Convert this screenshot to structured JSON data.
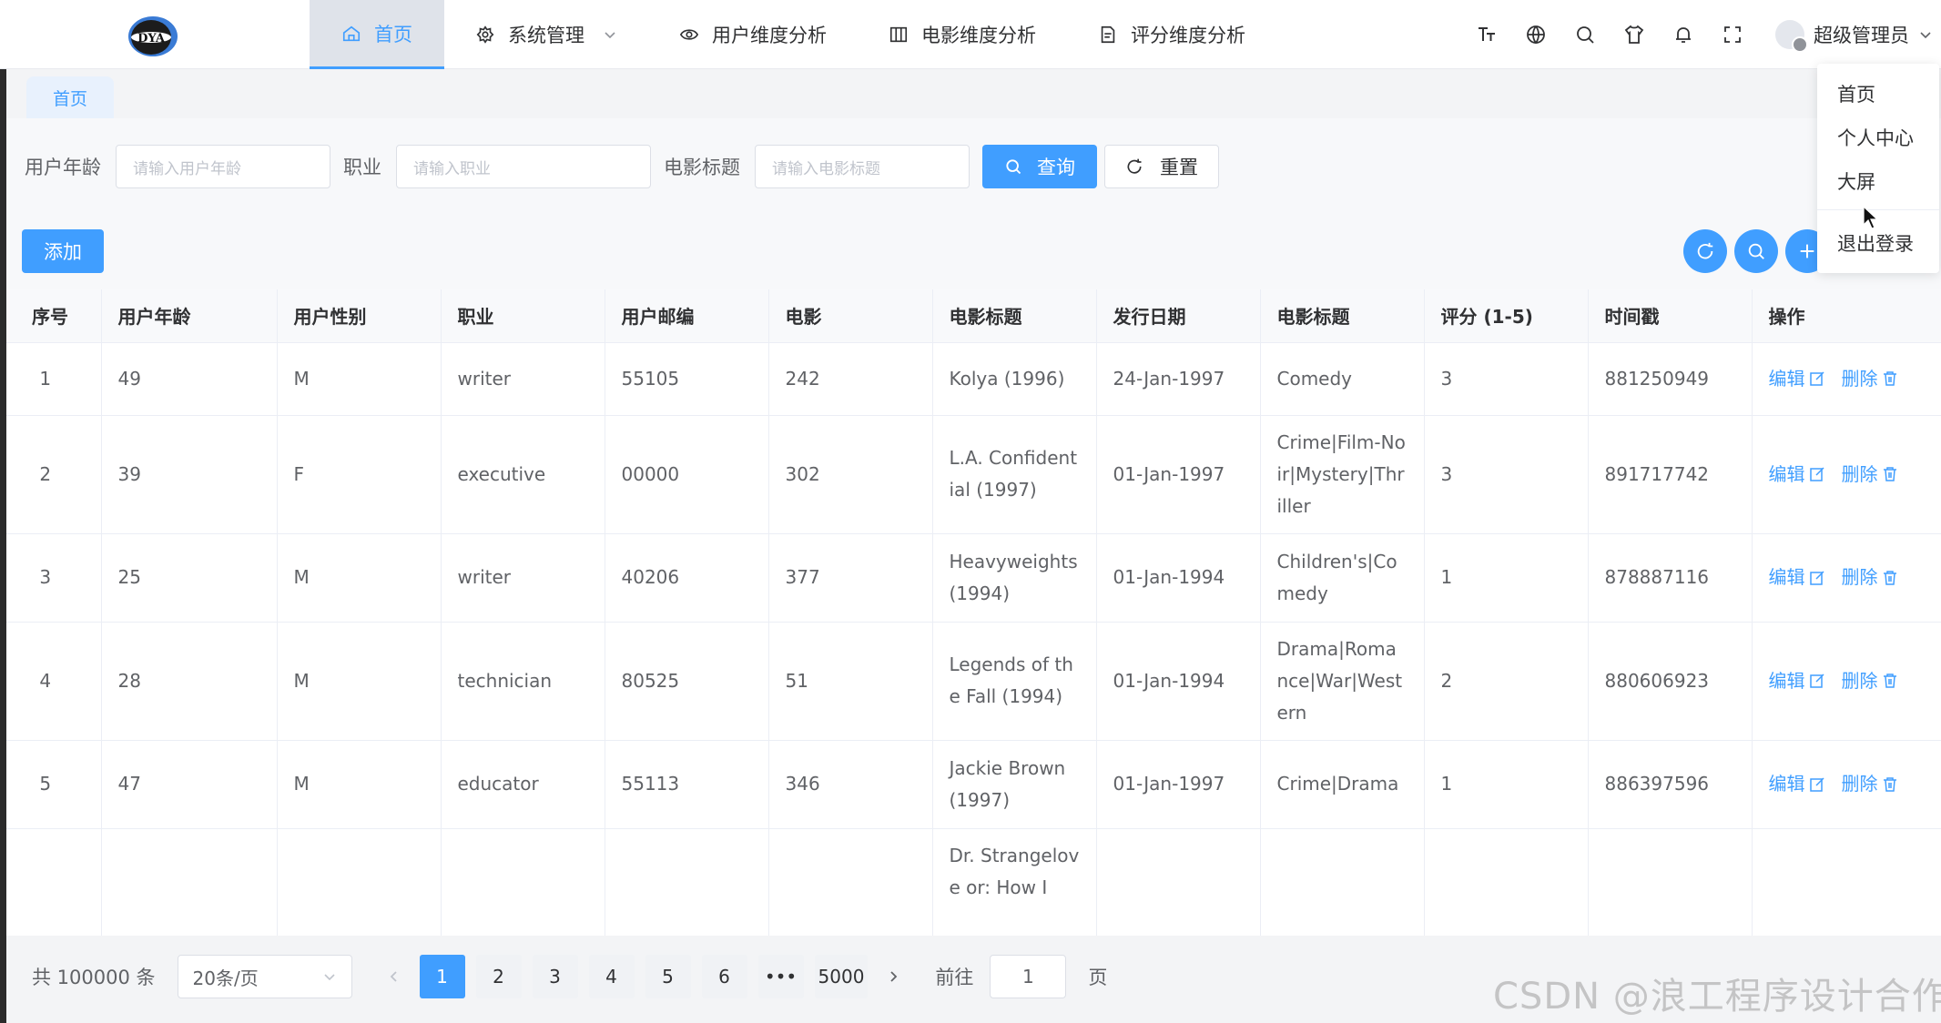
{
  "header": {
    "logo_text": "DYA",
    "nav": [
      {
        "label": "首页",
        "icon": "home-icon",
        "active": true
      },
      {
        "label": "系统管理",
        "icon": "gear-icon",
        "has_caret": true
      },
      {
        "label": "用户维度分析",
        "icon": "eye-icon"
      },
      {
        "label": "电影维度分析",
        "icon": "columns-icon"
      },
      {
        "label": "评分维度分析",
        "icon": "document-icon"
      }
    ],
    "tools": [
      "font-size-icon",
      "globe-icon",
      "search-icon",
      "shirt-icon",
      "bell-icon",
      "fullscreen-icon"
    ],
    "user_name": "超级管理员"
  },
  "tabs": [
    {
      "label": "首页",
      "active": true
    }
  ],
  "search": {
    "age_label": "用户年龄",
    "age_placeholder": "请输入用户年龄",
    "occupation_label": "职业",
    "occupation_placeholder": "请输入职业",
    "title_label": "电影标题",
    "title_placeholder": "请输入电影标题",
    "query_label": "查询",
    "reset_label": "重置"
  },
  "toolbar": {
    "add_label": "添加"
  },
  "table": {
    "columns": [
      "序号",
      "用户年龄",
      "用户性别",
      "职业",
      "用户邮编",
      "电影",
      "电影标题",
      "发行日期",
      "电影标题",
      "评分 (1-5)",
      "时间戳",
      "操作"
    ],
    "edit_label": "编辑",
    "delete_label": "删除",
    "rows": [
      [
        "1",
        "49",
        "M",
        "writer",
        "55105",
        "242",
        "Kolya (1996)",
        "24-Jan-1997",
        "Comedy",
        "3",
        "881250949"
      ],
      [
        "2",
        "39",
        "F",
        "executive",
        "00000",
        "302",
        "L.A. Confidential (1997)",
        "01-Jan-1997",
        "Crime|Film-Noir|Mystery|Thriller",
        "3",
        "891717742"
      ],
      [
        "3",
        "25",
        "M",
        "writer",
        "40206",
        "377",
        "Heavyweights (1994)",
        "01-Jan-1994",
        "Children's|Comedy",
        "1",
        "878887116"
      ],
      [
        "4",
        "28",
        "M",
        "technician",
        "80525",
        "51",
        "Legends of the Fall (1994)",
        "01-Jan-1994",
        "Drama|Romance|War|Western",
        "2",
        "880606923"
      ],
      [
        "5",
        "47",
        "M",
        "educator",
        "55113",
        "346",
        "Jackie Brown (1997)",
        "01-Jan-1997",
        "Crime|Drama",
        "1",
        "886397596"
      ],
      [
        "",
        "",
        "",
        "",
        "",
        "",
        "Dr. Strangelove or: How I",
        "",
        "",
        "",
        ""
      ]
    ]
  },
  "pagination": {
    "total_text": "共 100000 条",
    "page_size": "20条/页",
    "pages": [
      "1",
      "2",
      "3",
      "4",
      "5",
      "6",
      "•••",
      "5000"
    ],
    "current_page": "1",
    "goto_label": "前往",
    "goto_value": "1",
    "page_suffix": "页"
  },
  "user_menu": {
    "items": [
      "首页",
      "个人中心",
      "大屏",
      "退出登录"
    ]
  },
  "watermark": "CSDN @浪工程序设计合作",
  "colors": {
    "primary": "#409eff",
    "header_bg": "#ffffff",
    "active_nav_bg": "#dfe3ea"
  }
}
